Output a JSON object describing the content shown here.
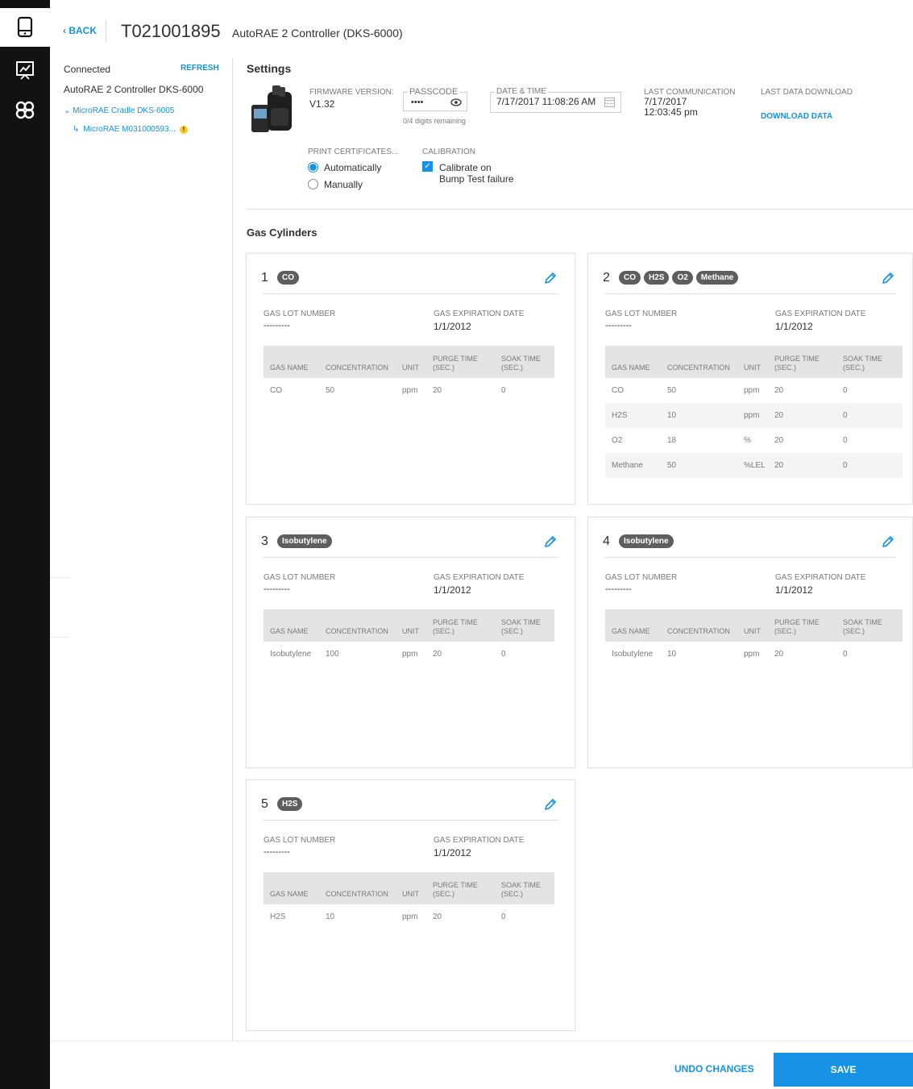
{
  "header": {
    "back_label": "‹ BACK",
    "serial": "T021001895",
    "device_name": "AutoRAE 2 Controller (DKS-6000)"
  },
  "nav": {
    "icons": [
      "device-icon",
      "presentation-chart-icon",
      "group-icon"
    ]
  },
  "left_panel": {
    "status": "Connected",
    "refresh_label": "REFRESH",
    "device": "AutoRAE 2 Controller DKS-6000",
    "cradle": "MicroRAE Cradle DKS-6005",
    "instrument": "MicroRAE M031000593...",
    "warning_glyph": "!"
  },
  "settings": {
    "title": "Settings",
    "firmware_label": "FIRMWARE VERSION:",
    "firmware_value": "V1.32",
    "passcode_label": "PASSCODE",
    "passcode_value": "••••",
    "passcode_hint": "0/4 digits remaining",
    "datetime_label": "DATE & TIME",
    "datetime_value": "7/17/2017 11:08:26 AM",
    "last_comm_label": "LAST COMMUNICATION",
    "last_comm_date": "7/17/2017",
    "last_comm_time": "12:03:45 pm",
    "last_download_label": "LAST DATA DOWNLOAD",
    "download_link": "DOWNLOAD DATA",
    "print_label": "PRINT CERTIFICATES...",
    "print_options": [
      "Automatically",
      "Manually"
    ],
    "print_selected": "Automatically",
    "calibration_label": "CALIBRATION",
    "calibration_line1": "Calibrate on",
    "calibration_line2": "Bump Test failure",
    "calibration_checked": true
  },
  "gas_cylinders": {
    "title": "Gas Cylinders",
    "lot_label": "GAS LOT NUMBER",
    "expiry_label": "GAS EXPIRATION DATE",
    "col_gas": "GAS NAME",
    "col_conc": "CONCENTRATION",
    "col_unit": "UNIT",
    "col_purge1": "PURGE TIME",
    "col_purge2": "(SEC.)",
    "col_soak1": "SOAK TIME",
    "col_soak2": "(SEC.)",
    "cards": [
      {
        "number": "1",
        "chips": [
          "CO"
        ],
        "lot": "---------",
        "expiry": "1/1/2012",
        "rows": [
          [
            "CO",
            "50",
            "ppm",
            "20",
            "0"
          ]
        ]
      },
      {
        "number": "2",
        "chips": [
          "CO",
          "H2S",
          "O2",
          "Methane"
        ],
        "lot": "---------",
        "expiry": "1/1/2012",
        "rows": [
          [
            "CO",
            "50",
            "ppm",
            "20",
            "0"
          ],
          [
            "H2S",
            "10",
            "ppm",
            "20",
            "0"
          ],
          [
            "O2",
            "18",
            "%",
            "20",
            "0"
          ],
          [
            "Methane",
            "50",
            "%LEL",
            "20",
            "0"
          ]
        ]
      },
      {
        "number": "3",
        "chips": [
          "Isobutylene"
        ],
        "lot": "---------",
        "expiry": "1/1/2012",
        "rows": [
          [
            "Isobutylene",
            "100",
            "ppm",
            "20",
            "0"
          ]
        ]
      },
      {
        "number": "4",
        "chips": [
          "Isobutylene"
        ],
        "lot": "---------",
        "expiry": "1/1/2012",
        "rows": [
          [
            "Isobutylene",
            "10",
            "ppm",
            "20",
            "0"
          ]
        ]
      },
      {
        "number": "5",
        "chips": [
          "H2S"
        ],
        "lot": "---------",
        "expiry": "1/1/2012",
        "rows": [
          [
            "H2S",
            "10",
            "ppm",
            "20",
            "0"
          ]
        ]
      }
    ]
  },
  "footer": {
    "undo_label": "UNDO CHANGES",
    "save_label": "SAVE"
  },
  "colors": {
    "accent": "#1792e5",
    "rail": "#121212",
    "chip": "#5e5e5e",
    "warning": "#ffc627"
  }
}
